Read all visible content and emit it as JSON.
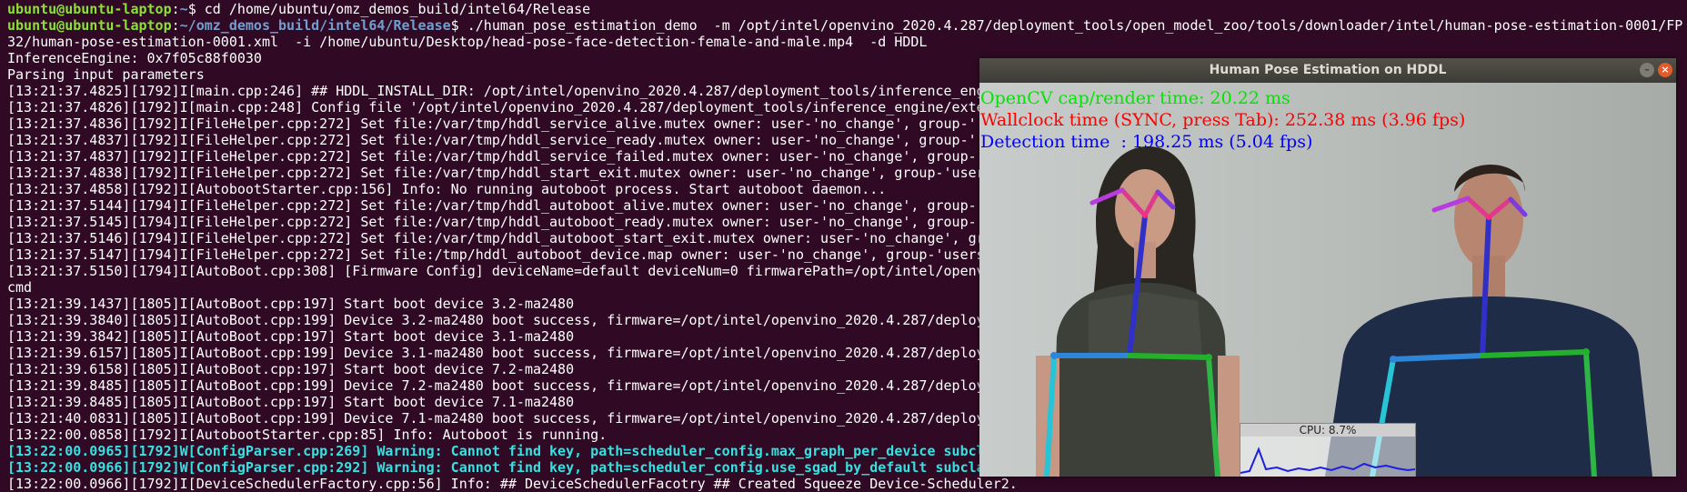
{
  "terminal": {
    "line1": {
      "prompt_user": "ubuntu@ubuntu-laptop",
      "prompt_dir": "~",
      "command": "cd /home/ubuntu/omz_demos_build/intel64/Release"
    },
    "line2": {
      "prompt_user": "ubuntu@ubuntu-laptop",
      "prompt_dir": "~/omz_demos_build/intel64/Release",
      "command": "./human_pose_estimation_demo  -m /opt/intel/openvino_2020.4.287/deployment_tools/open_model_zoo/tools/downloader/intel/human-pose-estimation-0001/FP"
    },
    "output": [
      "32/human-pose-estimation-0001.xml  -i /home/ubuntu/Desktop/head-pose-face-detection-female-and-male.mp4  -d HDDL",
      "InferenceEngine: 0x7f05c88f0030",
      "Parsing input parameters",
      "[13:21:37.4825][1792]I[main.cpp:246] ## HDDL_INSTALL_DIR: /opt/intel/openvino_2020.4.287/deployment_tools/inference_eng",
      "[13:21:37.4826][1792]I[main.cpp:248] Config file '/opt/intel/openvino_2020.4.287/deployment_tools/inference_engine/exte",
      "[13:21:37.4836][1792]I[FileHelper.cpp:272] Set file:/var/tmp/hddl_service_alive.mutex owner: user-'no_change', group-'",
      "[13:21:37.4837][1792]I[FileHelper.cpp:272] Set file:/var/tmp/hddl_service_ready.mutex owner: user-'no_change', group-'",
      "[13:21:37.4837][1792]I[FileHelper.cpp:272] Set file:/var/tmp/hddl_service_failed.mutex owner: user-'no_change', group-'",
      "[13:21:37.4838][1792]I[FileHelper.cpp:272] Set file:/var/tmp/hddl_start_exit.mutex owner: user-'no_change', group-'user",
      "[13:21:37.4858][1792]I[AutobootStarter.cpp:156] Info: No running autoboot process. Start autoboot daemon...",
      "[13:21:37.5144][1794]I[FileHelper.cpp:272] Set file:/var/tmp/hddl_autoboot_alive.mutex owner: user-'no_change', group-'",
      "[13:21:37.5145][1794]I[FileHelper.cpp:272] Set file:/var/tmp/hddl_autoboot_ready.mutex owner: user-'no_change', group-'",
      "[13:21:37.5146][1794]I[FileHelper.cpp:272] Set file:/var/tmp/hddl_autoboot_start_exit.mutex owner: user-'no_change', gr",
      "[13:21:37.5147][1794]I[FileHelper.cpp:272] Set file:/tmp/hddl_autoboot_device.map owner: user-'no_change', group-'users",
      "[13:21:37.5150][1794]I[AutoBoot.cpp:308] [Firmware Config] deviceName=default deviceNum=0 firmwarePath=/opt/intel/openv",
      "cmd",
      "[13:21:39.1437][1805]I[AutoBoot.cpp:197] Start boot device 3.2-ma2480",
      "[13:21:39.3840][1805]I[AutoBoot.cpp:199] Device 3.2-ma2480 boot success, firmware=/opt/intel/openvino_2020.4.287/deploy",
      "[13:21:39.3842][1805]I[AutoBoot.cpp:197] Start boot device 3.1-ma2480",
      "[13:21:39.6157][1805]I[AutoBoot.cpp:199] Device 3.1-ma2480 boot success, firmware=/opt/intel/openvino_2020.4.287/deploy",
      "[13:21:39.6158][1805]I[AutoBoot.cpp:197] Start boot device 7.2-ma2480",
      "[13:21:39.8485][1805]I[AutoBoot.cpp:199] Device 7.2-ma2480 boot success, firmware=/opt/intel/openvino_2020.4.287/deploy",
      "[13:21:39.8485][1805]I[AutoBoot.cpp:197] Start boot device 7.1-ma2480",
      "[13:21:40.0831][1805]I[AutoBoot.cpp:199] Device 7.1-ma2480 boot success, firmware=/opt/intel/openvino_2020.4.287/deploy",
      "[13:22:00.0858][1792]I[AutobootStarter.cpp:85] Info: Autoboot is running."
    ],
    "warnings": [
      "[13:22:00.0965][1792]W[ConfigParser.cpp:269] Warning: Cannot find key, path=scheduler_config.max_graph_per_device subcl",
      "[13:22:00.0966][1792]W[ConfigParser.cpp:292] Warning: Cannot find key, path=scheduler_config.use_sgad_by_default subcla"
    ],
    "last_line": "[13:22:00.0966][1792]I[DeviceSchedulerFactory.cpp:56] Info: ## DeviceSchedulerFacotry ## Created Squeeze Device-Scheduler2."
  },
  "window": {
    "title": "Human Pose Estimation on HDDL",
    "min_icon": "minimize-icon",
    "close_icon": "close-icon",
    "overlay": {
      "render_time": "OpenCV cap/render time: 20.22 ms",
      "wallclock": "Wallclock time (SYNC, press Tab): 252.38 ms (3.96 fps)",
      "detection": "Detection time  : 198.25 ms (5.04 fps)"
    },
    "cpu_label": "CPU: 8.7%"
  },
  "colors": {
    "terminal_bg": "#300a24",
    "prompt_user": "#8ae234",
    "prompt_dir": "#729fcf",
    "warning": "#34e2e2",
    "overlay_green": "#00e600",
    "overlay_red": "#ff0000",
    "overlay_blue": "#0000ff"
  }
}
